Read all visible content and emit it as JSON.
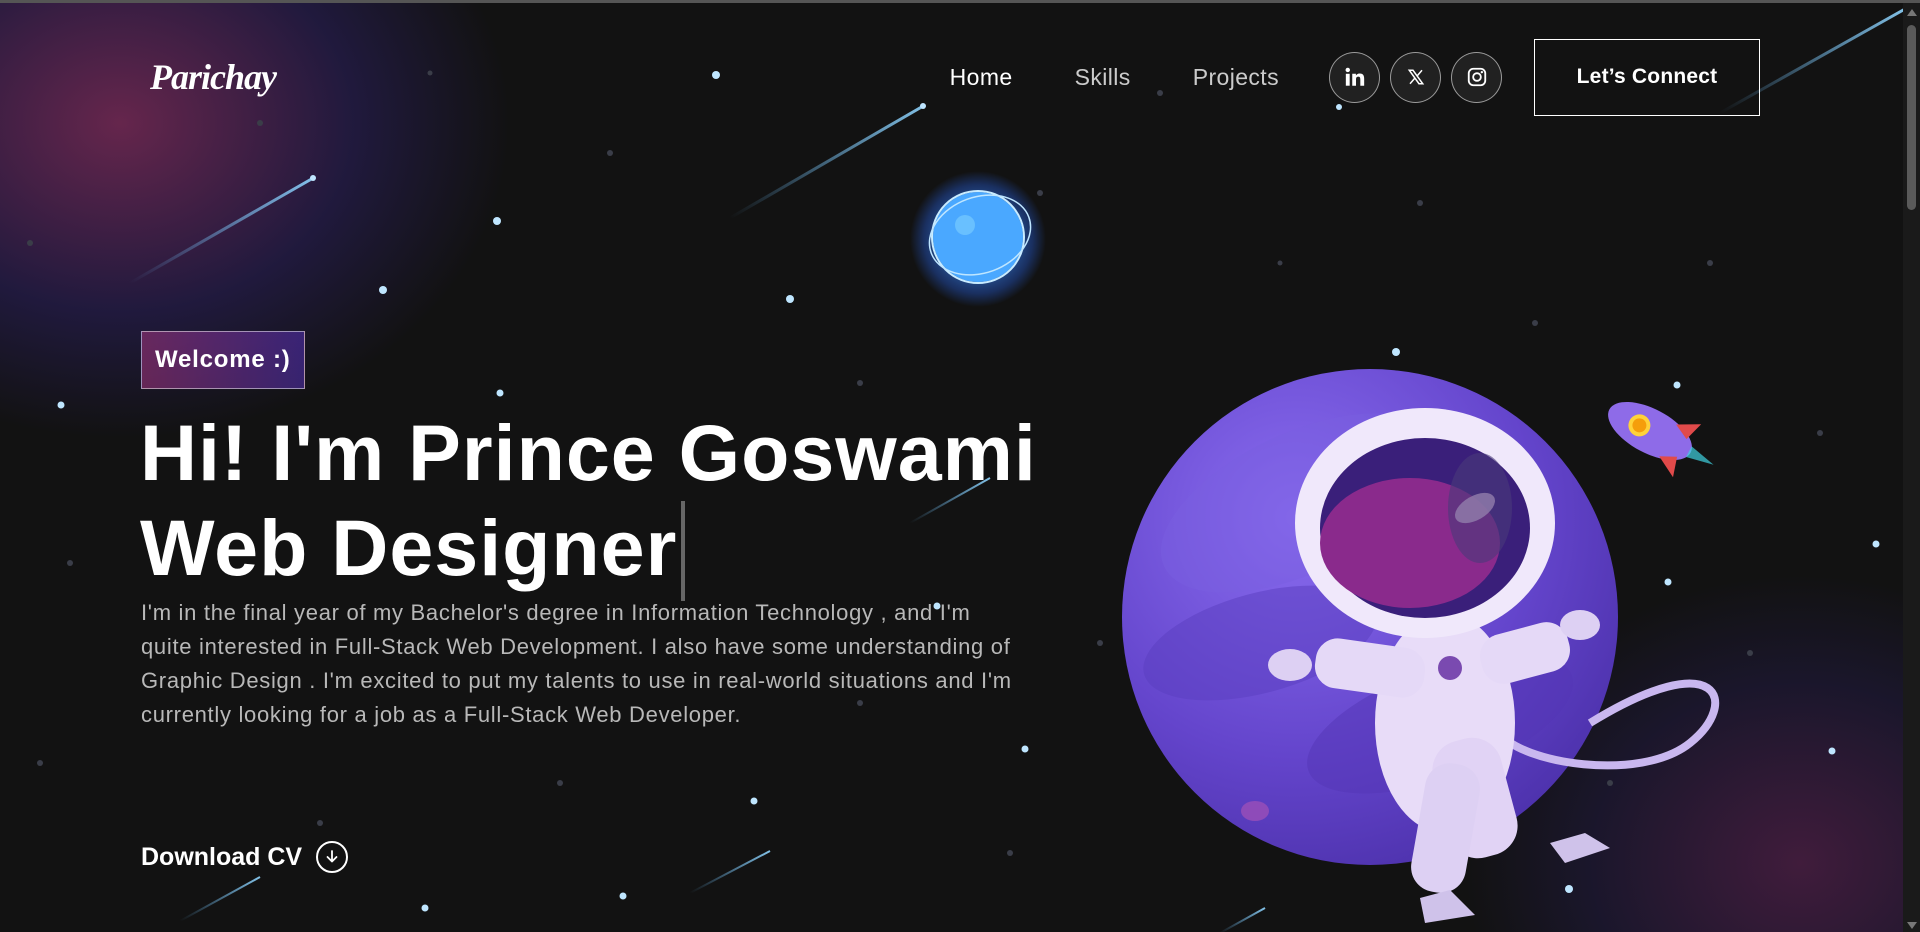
{
  "nav": {
    "logo": "Parichay",
    "links": [
      "Home",
      "Skills",
      "Projects"
    ],
    "socials": [
      "linkedin-icon",
      "x-icon",
      "instagram-icon"
    ],
    "connect_label": "Let’s Connect"
  },
  "hero": {
    "tagline": "Welcome :)",
    "headline_line1": "Hi! I'm Prince Goswami",
    "headline_line2": "Web Designer",
    "intro": "I'm in the final year of my Bachelor's degree in Information Technology , and I'm quite interested in Full-Stack Web Development. I also have some understanding of Graphic Design . I'm excited to put my talents to use in real-world situations and I'm currently looking for a job as a Full-Stack Web Developer.",
    "download_label": "Download CV"
  },
  "colors": {
    "background": "#121212",
    "accent_pink": "#AA367C",
    "accent_purple": "#4A2FBD",
    "planet": "#6A4BD0"
  }
}
